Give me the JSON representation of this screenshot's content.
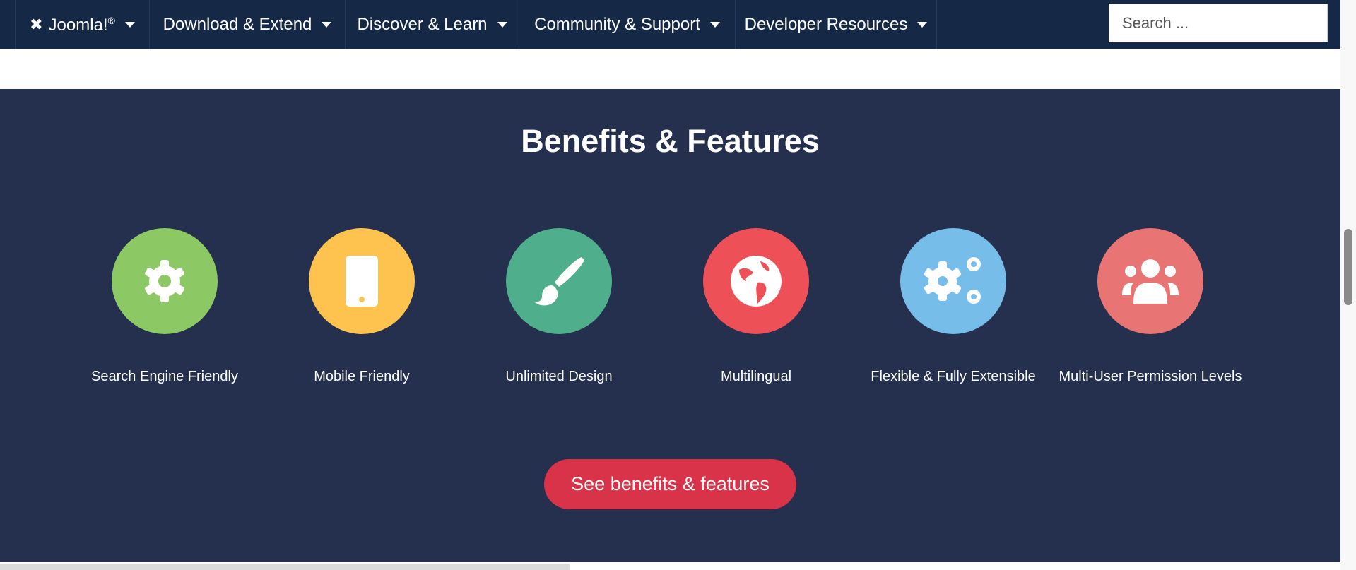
{
  "nav": {
    "brand": "Joomla!",
    "brand_mark": "®",
    "items": [
      "Download & Extend",
      "Discover & Learn",
      "Community & Support",
      "Developer Resources"
    ],
    "search_placeholder": "Search ..."
  },
  "section": {
    "title": "Benefits & Features",
    "features": [
      {
        "label": "Search Engine Friendly",
        "icon": "gear-icon",
        "color": "#8cc863"
      },
      {
        "label": "Mobile Friendly",
        "icon": "mobile-icon",
        "color": "#fdc34e"
      },
      {
        "label": "Unlimited Design",
        "icon": "paintbrush-icon",
        "color": "#4fae8b"
      },
      {
        "label": "Multilingual",
        "icon": "globe-icon",
        "color": "#ee5057"
      },
      {
        "label": "Flexible & Fully Extensible",
        "icon": "gears-icon",
        "color": "#76bde9"
      },
      {
        "label": "Multi-User Permission Levels",
        "icon": "users-icon",
        "color": "#e87574"
      }
    ],
    "cta": "See benefits & features"
  }
}
